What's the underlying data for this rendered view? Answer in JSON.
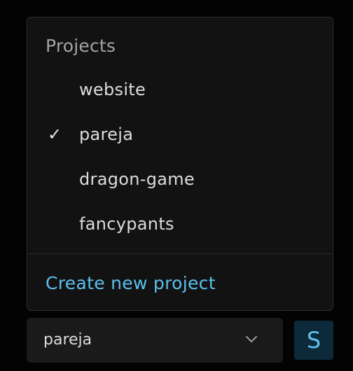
{
  "menu": {
    "heading": "Projects",
    "items": [
      {
        "label": "website",
        "checked": false
      },
      {
        "label": "pareja",
        "checked": true
      },
      {
        "label": "dragon-game",
        "checked": false
      },
      {
        "label": "fancypants",
        "checked": false
      }
    ],
    "check_glyph": "✓",
    "create_label": "Create new project"
  },
  "selector": {
    "value": "pareja",
    "icon": "chevron-down-icon"
  },
  "avatar": {
    "initial": "S"
  },
  "colors": {
    "background": "#030303",
    "panel": "#121212",
    "accent": "#5cc0ee",
    "text": "#dcdcdc",
    "muted": "#a4a4a4"
  }
}
